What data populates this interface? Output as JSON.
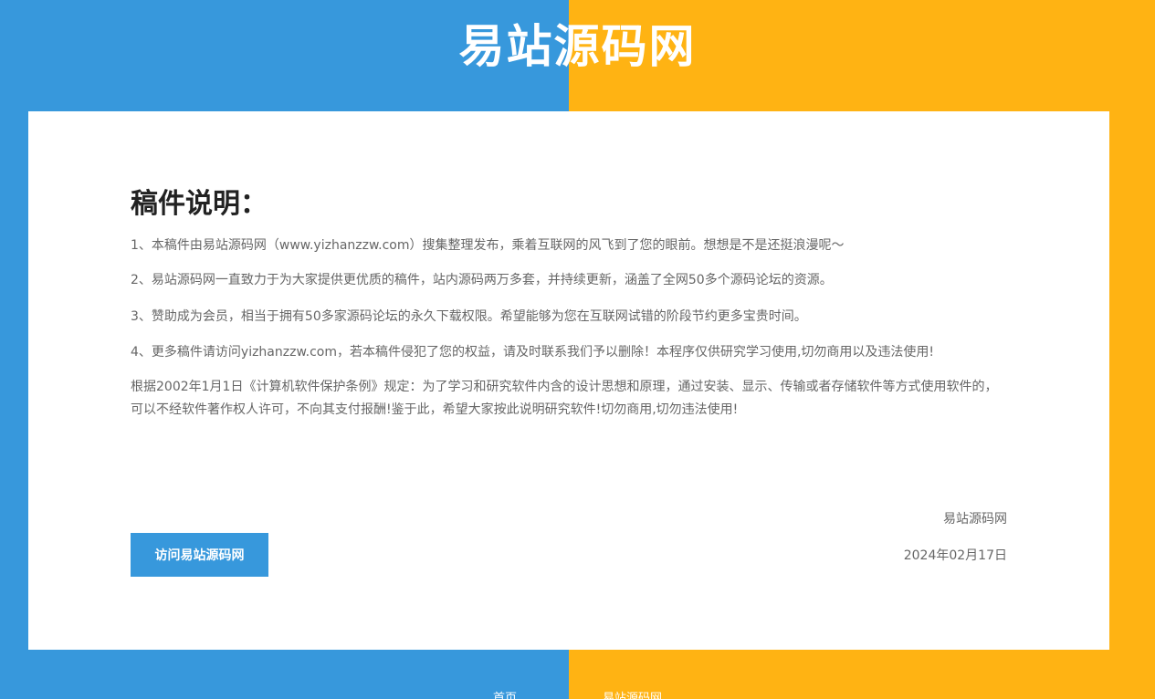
{
  "site": {
    "title": "易站源码网"
  },
  "notice": {
    "heading": "稿件说明：",
    "paragraphs": [
      "1、本稿件由易站源码网（www.yizhanzzw.com）搜集整理发布，乘着互联网的风飞到了您的眼前。想想是不是还挺浪漫呢～",
      "2、易站源码网一直致力于为大家提供更优质的稿件，站内源码两万多套，并持续更新，涵盖了全网50多个源码论坛的资源。",
      "3、赞助成为会员，相当于拥有50多家源码论坛的永久下载权限。希望能够为您在互联网试错的阶段节约更多宝贵时间。",
      "4、更多稿件请访问yizhanzzw.com，若本稿件侵犯了您的权益，请及时联系我们予以删除！本程序仅供研究学习使用,切勿商用以及违法使用!",
      "根据2002年1月1日《计算机软件保护条例》规定：为了学习和研究软件内含的设计思想和原理，通过安装、显示、传输或者存储软件等方式使用软件的，可以不经软件著作权人许可，不向其支付报酬!鉴于此，希望大家按此说明研究软件!切勿商用,切勿违法使用!"
    ],
    "signature": "易站源码网",
    "date": "2024年02月17日"
  },
  "actions": {
    "visit_label": "访问易站源码网"
  },
  "footer": {
    "left_text": "首页",
    "right_text": "易站源码网"
  },
  "colors": {
    "blue": "#3798dc",
    "orange": "#ffb313"
  }
}
